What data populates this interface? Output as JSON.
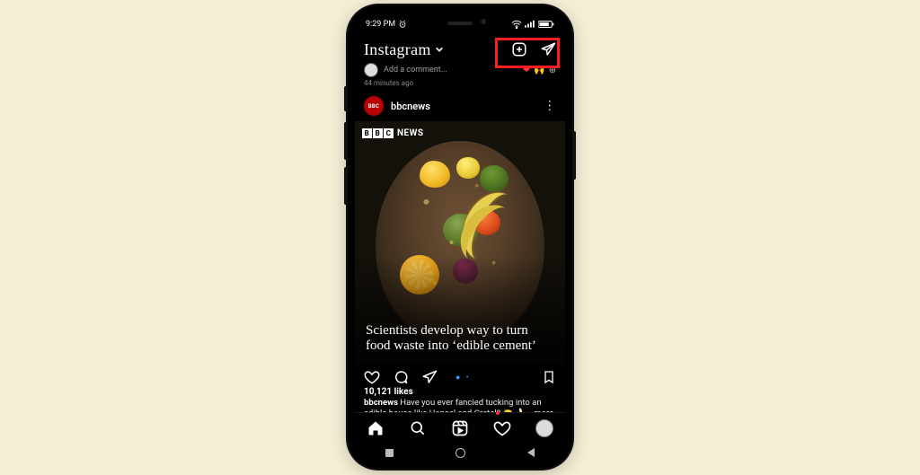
{
  "status": {
    "time": "9:29 PM",
    "alarm_icon": "alarm-icon"
  },
  "header": {
    "brand": "Instagram"
  },
  "prev_post": {
    "placeholder": "Add a comment...",
    "time_ago": "44 minutes ago"
  },
  "post": {
    "username": "bbcnews",
    "avatar_text": "BBC",
    "watermark_text": "NEWS",
    "headline": "Scientists develop way to turn food waste into ‘edible cement’",
    "likes": "10,121 likes",
    "caption_user": "bbcnews",
    "caption_text": " Have you ever fancied tucking into an edible house like Hansel and Gretel? 🍋 🍌 …more"
  },
  "colors": {
    "accent_red": "#ff1e1e",
    "like_red": "#ff3040",
    "link_blue": "#3897f0"
  }
}
